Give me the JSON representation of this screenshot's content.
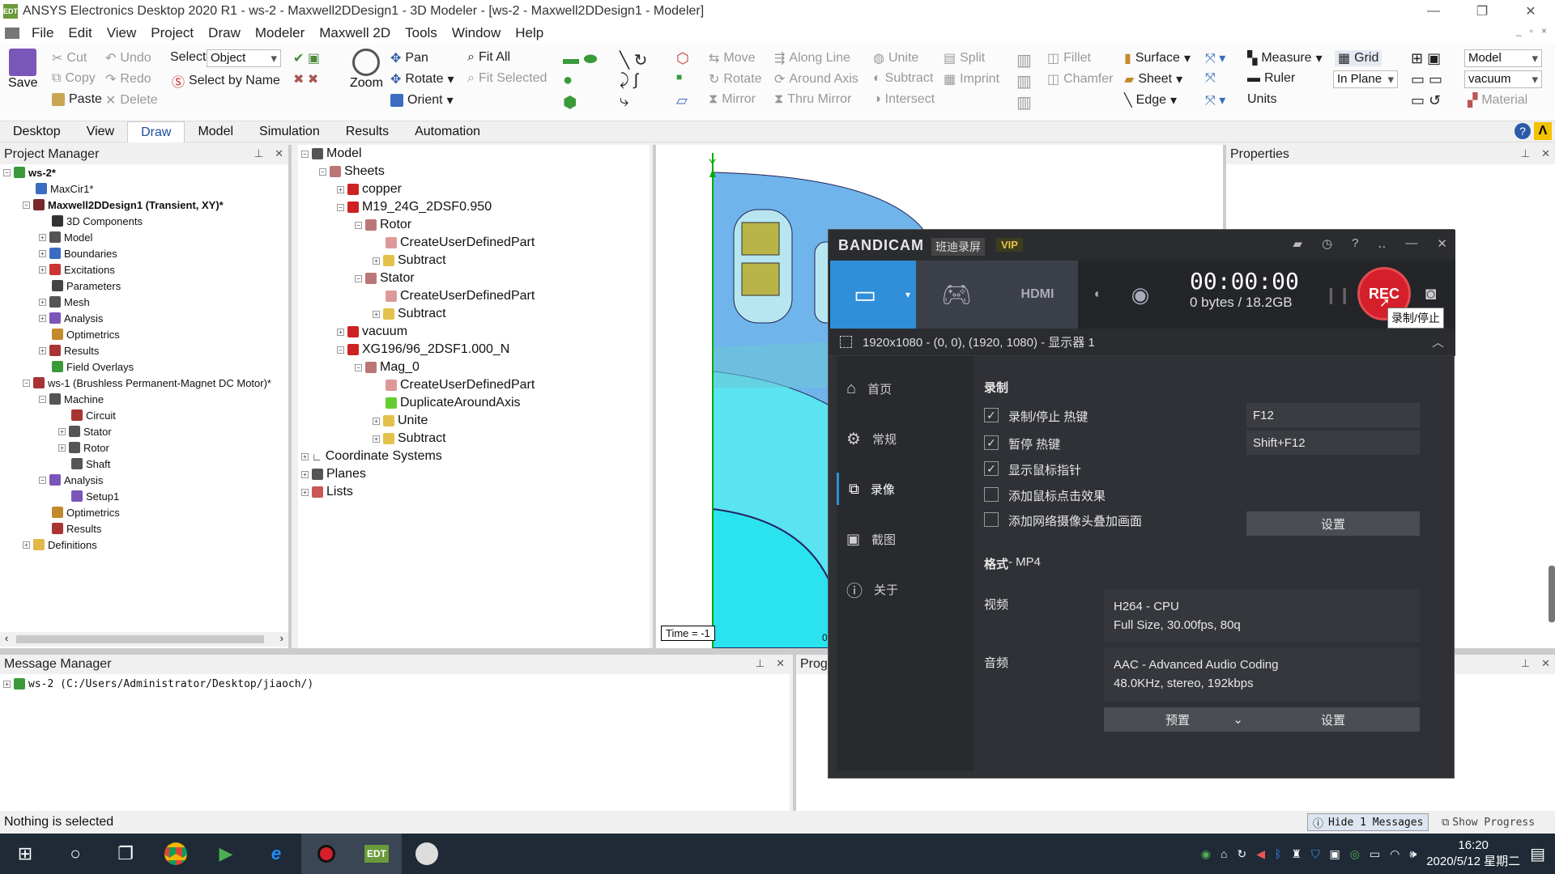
{
  "window": {
    "title": "ANSYS Electronics Desktop 2020 R1 - ws-2 - Maxwell2DDesign1 - 3D Modeler - [ws-2 - Maxwell2DDesign1 - Modeler]",
    "app_icon": "EDT"
  },
  "menu": [
    "File",
    "Edit",
    "View",
    "Project",
    "Draw",
    "Modeler",
    "Maxwell 2D",
    "Tools",
    "Window",
    "Help"
  ],
  "ribbon": {
    "save": "Save",
    "cut": "Cut",
    "copy": "Copy",
    "paste": "Paste",
    "undo": "Undo",
    "redo": "Redo",
    "delete": "Delete",
    "select_label": "Select:",
    "select_value": "Object",
    "select_by_name": "Select by Name",
    "zoom": "Zoom",
    "pan": "Pan",
    "rotate": "Rotate",
    "orient": "Orient",
    "fit_all": "Fit All",
    "fit_selected": "Fit Selected",
    "move": "Move",
    "rotate2": "Rotate",
    "mirror": "Mirror",
    "along_line": "Along Line",
    "around_axis": "Around Axis",
    "thru_mirror": "Thru Mirror",
    "unite": "Unite",
    "subtract": "Subtract",
    "intersect": "Intersect",
    "split": "Split",
    "imprint": "Imprint",
    "fillet": "Fillet",
    "chamfer": "Chamfer",
    "surface": "Surface",
    "sheet": "Sheet",
    "edge": "Edge",
    "measure": "Measure",
    "ruler": "Ruler",
    "units": "Units",
    "grid": "Grid",
    "in_plane": "In Plane",
    "model_sel": "Model",
    "vacuum_sel": "vacuum",
    "material": "Material"
  },
  "tabs": [
    "Desktop",
    "View",
    "Draw",
    "Model",
    "Simulation",
    "Results",
    "Automation"
  ],
  "active_tab": "Draw",
  "project_manager": {
    "title": "Project Manager",
    "items": [
      {
        "label": "ws-2*",
        "bold": true
      },
      {
        "label": "MaxCir1*"
      },
      {
        "label": "Maxwell2DDesign1 (Transient, XY)*",
        "bold": true
      },
      {
        "label": "3D Components"
      },
      {
        "label": "Model"
      },
      {
        "label": "Boundaries"
      },
      {
        "label": "Excitations"
      },
      {
        "label": "Parameters"
      },
      {
        "label": "Mesh"
      },
      {
        "label": "Analysis"
      },
      {
        "label": "Optimetrics"
      },
      {
        "label": "Results"
      },
      {
        "label": "Field Overlays"
      },
      {
        "label": "ws-1 (Brushless Permanent-Magnet DC Motor)*"
      },
      {
        "label": "Machine"
      },
      {
        "label": "Circuit"
      },
      {
        "label": "Stator"
      },
      {
        "label": "Rotor"
      },
      {
        "label": "Shaft"
      },
      {
        "label": "Analysis"
      },
      {
        "label": "Setup1"
      },
      {
        "label": "Optimetrics"
      },
      {
        "label": "Results"
      },
      {
        "label": "Definitions"
      }
    ]
  },
  "history_tree": [
    {
      "label": "Model"
    },
    {
      "label": "Sheets"
    },
    {
      "label": "copper"
    },
    {
      "label": "M19_24G_2DSF0.950"
    },
    {
      "label": "Rotor"
    },
    {
      "label": "CreateUserDefinedPart"
    },
    {
      "label": "Subtract"
    },
    {
      "label": "Stator"
    },
    {
      "label": "CreateUserDefinedPart"
    },
    {
      "label": "Subtract"
    },
    {
      "label": "vacuum"
    },
    {
      "label": "XG196/96_2DSF1.000_N"
    },
    {
      "label": "Mag_0"
    },
    {
      "label": "CreateUserDefinedPart"
    },
    {
      "label": "DuplicateAroundAxis"
    },
    {
      "label": "Unite"
    },
    {
      "label": "Subtract"
    },
    {
      "label": "Coordinate Systems"
    },
    {
      "label": "Planes"
    },
    {
      "label": "Lists"
    }
  ],
  "viewport": {
    "axis_label": "Y",
    "time_label": "Time = -1",
    "origin_label": "0"
  },
  "properties": {
    "title": "Properties"
  },
  "message_manager": {
    "title": "Message Manager",
    "entry": "ws-2 (C:/Users/Administrator/Desktop/jiaoch/)"
  },
  "progress": {
    "title": "Progr"
  },
  "status": {
    "text": "Nothing is selected",
    "hide_messages": "Hide 1 Messages",
    "show_progress": "Show Progress"
  },
  "clock": {
    "time": "16:20",
    "date": "2020/5/12 星期二"
  },
  "bandicam": {
    "logo": "BANDICAM",
    "cn_name": "班迪录屏",
    "vip": "VIP",
    "timer": "00:00:00",
    "bytes": "0 bytes / 18.2GB",
    "rec": "REC",
    "tooltip": "录制/停止",
    "resolution": "1920x1080 - (0, 0), (1920, 1080) - 显示器 1",
    "sidebar": [
      "首页",
      "常规",
      "录像",
      "截图",
      "关于"
    ],
    "active_side": "录像",
    "section_record": "录制",
    "options": [
      {
        "label": "录制/停止 热键",
        "checked": true
      },
      {
        "label": "暂停 热键",
        "checked": true
      },
      {
        "label": "显示鼠标指针",
        "checked": true
      },
      {
        "label": "添加鼠标点击效果",
        "checked": false
      },
      {
        "label": "添加网络摄像头叠加画面",
        "checked": false
      }
    ],
    "hotkey_rec": "F12",
    "hotkey_pause": "Shift+F12",
    "settings_btn": "设置",
    "format_label": "格式",
    "format_value": " - MP4",
    "video_label": "视频",
    "video_line1": "H264 - CPU",
    "video_line2": "Full Size, 30.00fps, 80q",
    "audio_label": "音频",
    "audio_line1": "AAC - Advanced Audio Coding",
    "audio_line2": "48.0KHz, stereo, 192kbps",
    "preset_btn": "预置",
    "settings_btn2": "设置"
  }
}
